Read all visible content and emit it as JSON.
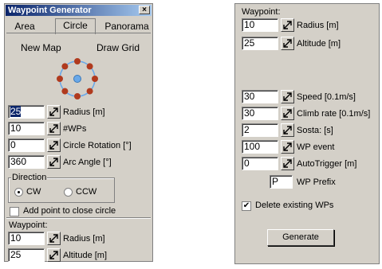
{
  "left": {
    "title": "Waypoint Generator",
    "close_glyph": "×",
    "tabs": [
      "Area",
      "Circle",
      "Panorama"
    ],
    "active_tab": "Circle",
    "new_map": "New Map",
    "draw_grid": "Draw Grid",
    "fields": [
      {
        "value": "25",
        "label": "Radius [m]",
        "selected": true
      },
      {
        "value": "10",
        "label": "#WPs"
      },
      {
        "value": "0",
        "label": "Circle Rotation [°]"
      },
      {
        "value": "360",
        "label": "Arc Angle [°]"
      }
    ],
    "direction": {
      "legend": "Direction",
      "cw": "CW",
      "ccw": "CCW",
      "selected": "CW"
    },
    "add_point_label": "Add point to close circle",
    "add_point_checked": false,
    "waypoint_section": "Waypoint:",
    "wp_fields": [
      {
        "value": "10",
        "label": "Radius [m]"
      },
      {
        "value": "25",
        "label": "Altitude [m]"
      }
    ]
  },
  "right": {
    "waypoint_section": "Waypoint:",
    "top_fields": [
      {
        "value": "10",
        "label": "Radius [m]"
      },
      {
        "value": "25",
        "label": "Altitude [m]"
      }
    ],
    "fields": [
      {
        "value": "30",
        "label": "Speed [0.1m/s]"
      },
      {
        "value": "30",
        "label": "Climb rate [0.1m/s]"
      },
      {
        "value": "2",
        "label": "Sosta: [s]"
      },
      {
        "value": "100",
        "label": "WP event"
      },
      {
        "value": "0",
        "label": "AutoTrigger [m]"
      }
    ],
    "prefix_value": "P",
    "prefix_label": "WP Prefix",
    "delete_label": "Delete existing WPs",
    "delete_checked": true,
    "generate_label": "Generate"
  },
  "colors": {
    "titlebar_start": "#0a246a",
    "titlebar_end": "#a6caf0",
    "panel_bg": "#d4d0c8",
    "waypoint_dot": "#b03a1e",
    "center_dot": "#6aa8e8"
  },
  "icons": {
    "spin": "spinner-arrows-icon",
    "circle_preview": "circle-waypoints-icon"
  }
}
